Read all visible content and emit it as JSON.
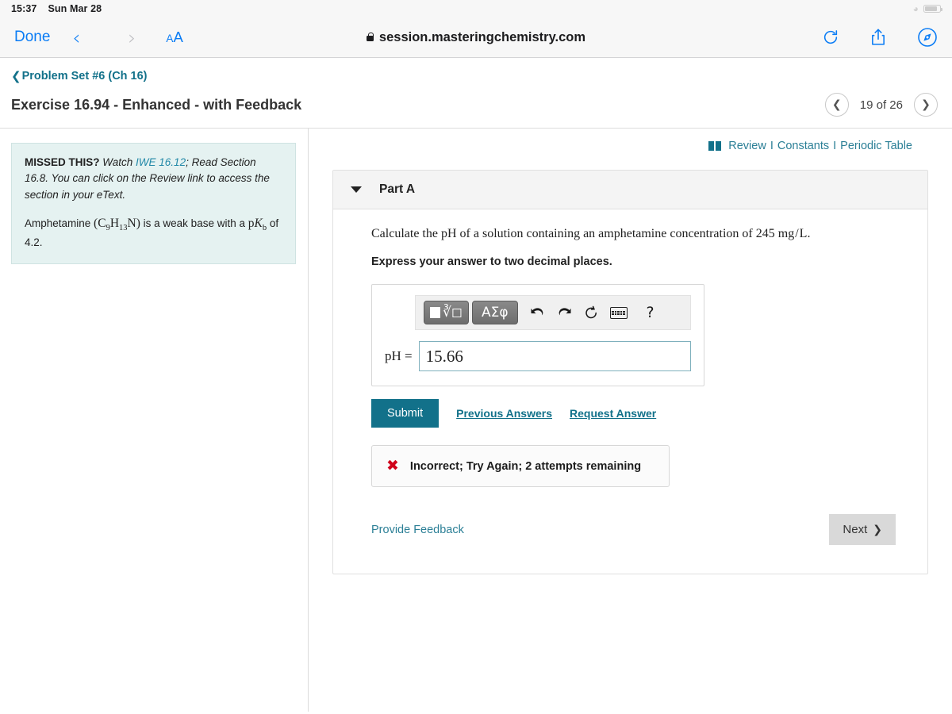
{
  "status_bar": {
    "time": "15:37",
    "date": "Sun Mar 28",
    "wifi_icon": "wifi-icon",
    "battery_icon": "battery-icon"
  },
  "browser": {
    "done_label": "Done",
    "back_icon": "chevron-left-icon",
    "forward_icon": "chevron-right-icon",
    "text_size_small": "A",
    "text_size_big": "A",
    "lock_icon": "lock-icon",
    "url": "session.masteringchemistry.com",
    "reload_icon": "reload-icon",
    "share_icon": "share-icon",
    "tabs_icon": "compass-icon"
  },
  "header": {
    "breadcrumb_chevron": "chevron-left-icon",
    "breadcrumb": "Problem Set #6 (Ch 16)",
    "title": "Exercise 16.94 - Enhanced - with Feedback",
    "pager": {
      "prev_icon": "chevron-left-icon",
      "label": "19 of 26",
      "next_icon": "chevron-right-icon"
    }
  },
  "sidebar": {
    "missed_label": "MISSED THIS?",
    "hint_part1": "Watch ",
    "hint_link": "IWE 16.12",
    "hint_part2": "; Read Section 16.8. You can click on the Review link to access the section in your eText.",
    "statement_pre": "Amphetamine ",
    "formula": "(C9H13N)",
    "statement_mid": " is a weak base with a ",
    "pkb": "pKb",
    "statement_post": " of 4.2."
  },
  "resources": {
    "book_icon": "book-icon",
    "review": "Review",
    "separator": "I",
    "constants": "Constants",
    "periodic_table": "Periodic Table"
  },
  "part": {
    "collapse_icon": "triangle-down-icon",
    "label": "Part A",
    "question_pre": "Calculate the ",
    "question_ph": "pH",
    "question_mid": " of a solution containing an amphetamine concentration of 245 ",
    "question_unit_num": "mg",
    "question_unit_slash": "/",
    "question_unit_den": "L",
    "question_end": ".",
    "instruction": "Express your answer to two decimal places."
  },
  "answer_widget": {
    "template_button": "math-template-button",
    "greek_button": "ΑΣφ",
    "undo_icon": "undo-icon",
    "redo_icon": "redo-icon",
    "reset_icon": "reset-icon",
    "keyboard_icon": "keyboard-icon",
    "help_icon": "?",
    "field_label": "pH =",
    "value": "15.66",
    "placeholder": ""
  },
  "actions": {
    "submit": "Submit",
    "previous_answers": "Previous Answers",
    "request_answer": "Request Answer"
  },
  "feedback": {
    "icon": "x-mark-icon",
    "icon_glyph": "✖",
    "message": "Incorrect; Try Again; 2 attempts remaining"
  },
  "footer": {
    "provide_feedback": "Provide Feedback",
    "next_label": "Next",
    "next_icon": "chevron-right-icon"
  },
  "colors": {
    "teal": "#12718a",
    "link_teal": "#2b7f96",
    "ios_blue": "#0a7cf5",
    "error_red": "#d0021b",
    "hint_bg": "#e5f2f1"
  }
}
